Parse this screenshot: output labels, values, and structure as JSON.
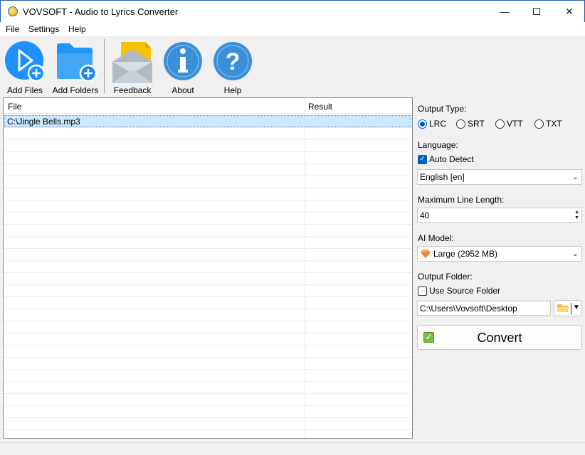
{
  "window": {
    "title": "VOVSOFT - Audio to Lyrics Converter"
  },
  "menu": {
    "file": "File",
    "settings": "Settings",
    "help": "Help"
  },
  "toolbar": {
    "add_files": "Add Files",
    "add_folders": "Add Folders",
    "feedback": "Feedback",
    "about": "About",
    "help": "Help"
  },
  "list": {
    "columns": {
      "file": "File",
      "result": "Result"
    },
    "rows": [
      {
        "file": "C:\\Jingle Bells.mp3",
        "result": ""
      }
    ]
  },
  "panel": {
    "output_type_label": "Output Type:",
    "output_types": [
      "LRC",
      "SRT",
      "VTT",
      "TXT"
    ],
    "output_type_selected": "LRC",
    "language_label": "Language:",
    "auto_detect_label": "Auto Detect",
    "auto_detect_checked": true,
    "language_value": "English [en]",
    "max_line_label": "Maximum Line Length:",
    "max_line_value": "40",
    "ai_model_label": "AI Model:",
    "ai_model_value": "Large (2952 MB)",
    "output_folder_label": "Output Folder:",
    "use_source_label": "Use Source Folder",
    "use_source_checked": false,
    "output_folder_value": "C:\\Users\\Vovsoft\\Desktop",
    "convert_label": "Convert"
  },
  "colors": {
    "accent": "#005fb8",
    "selection": "#cce8ff",
    "convert_check": "#7cc242"
  }
}
